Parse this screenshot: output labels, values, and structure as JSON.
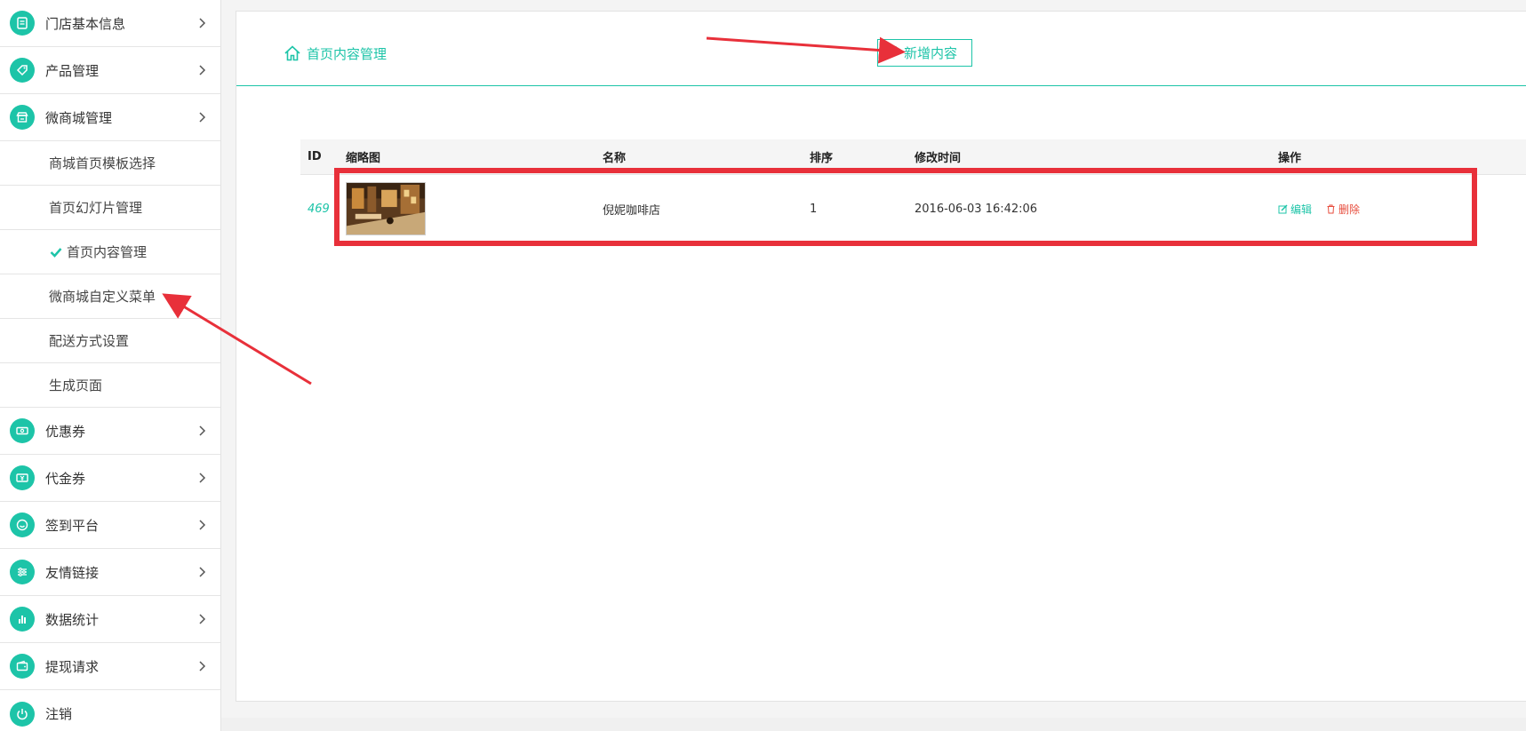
{
  "sidebar": {
    "top_items": [
      {
        "label": "门店基本信息"
      },
      {
        "label": "产品管理"
      },
      {
        "label": "微商城管理"
      }
    ],
    "sub_items": [
      {
        "label": "商城首页模板选择"
      },
      {
        "label": "首页幻灯片管理"
      },
      {
        "label": "首页内容管理"
      },
      {
        "label": "微商城自定义菜单"
      },
      {
        "label": "配送方式设置"
      },
      {
        "label": "生成页面"
      }
    ],
    "bottom_items": [
      {
        "label": "优惠券"
      },
      {
        "label": "代金券"
      },
      {
        "label": "签到平台"
      },
      {
        "label": "友情链接"
      },
      {
        "label": "数据统计"
      },
      {
        "label": "提现请求"
      },
      {
        "label": "注销"
      }
    ]
  },
  "header": {
    "breadcrumb": "首页内容管理",
    "add_button": "新增内容"
  },
  "table": {
    "columns": [
      "ID",
      "缩略图",
      "名称",
      "排序",
      "修改时间",
      "操作"
    ],
    "rows": [
      {
        "id": "469",
        "name": "倪妮咖啡店",
        "sort": "1",
        "modified": "2016-06-03 16:42:06",
        "edit_label": "编辑",
        "delete_label": "删除"
      }
    ]
  },
  "colors": {
    "accent": "#1dc4a8",
    "danger": "#e74c3c",
    "annotation": "#e8303a"
  }
}
